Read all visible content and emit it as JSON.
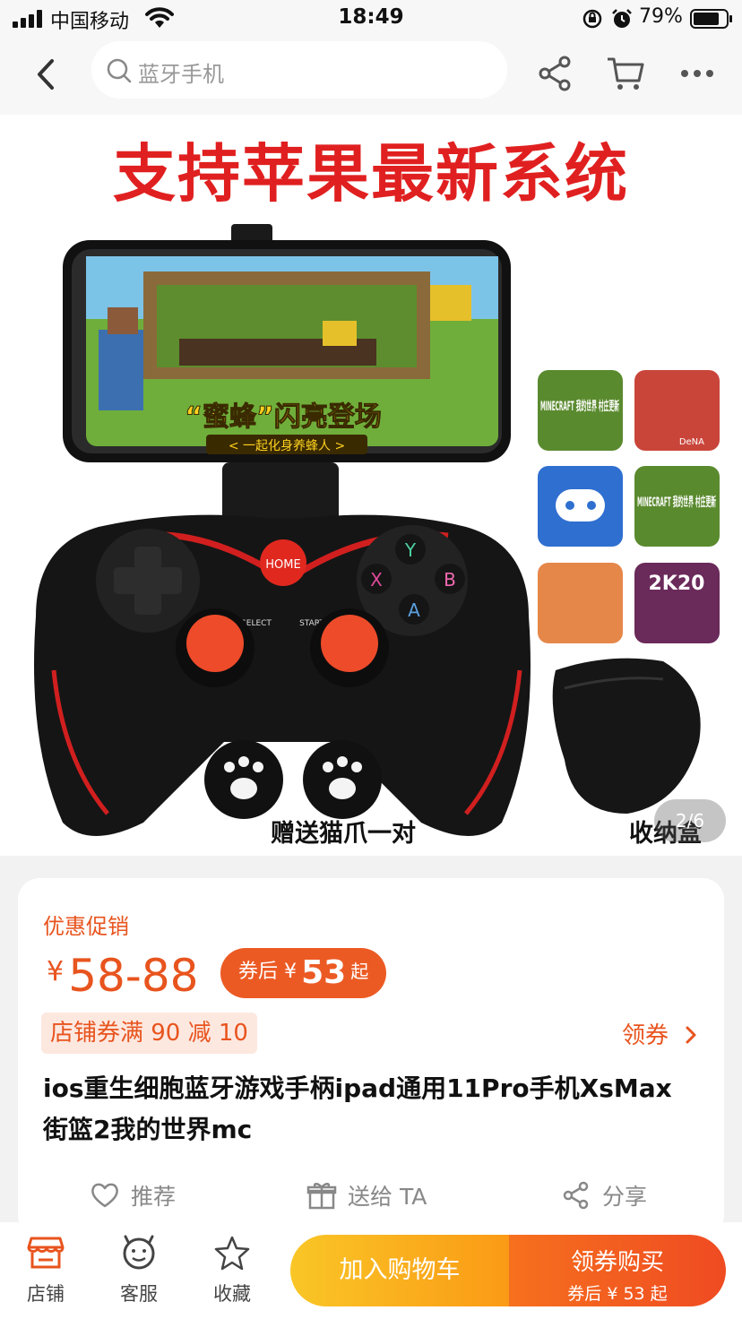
{
  "status_bar": {
    "carrier": "中国移动",
    "time": "18:49",
    "battery": "79%",
    "battery_level": 0.79
  },
  "nav": {
    "search_placeholder": "蓝牙手机"
  },
  "gallery": {
    "banner_text": "支持苹果最新系统",
    "phone_screen_title": "“蜜蜂”闪亮登场",
    "phone_screen_subtitle": "< 一起化身养蜂人 >",
    "game_icons": [
      "MINECRAFT 我的世界 村庄更新",
      "DeNA",
      "MINECRAFT 我的世界 村庄更新",
      "2K20"
    ],
    "controller_buttons": [
      "Y",
      "X",
      "B",
      "A"
    ],
    "controller_small_labels": [
      "SELECT",
      "START",
      "HOME"
    ],
    "caption_paw": "赠送猫爪一对",
    "caption_case": "收纳盒",
    "counter": "2/6"
  },
  "product": {
    "promo_label": "优惠促销",
    "currency": "¥",
    "price_range": "58-88",
    "coupon_prefix": "券后 ¥",
    "coupon_price": "53",
    "coupon_suffix": "起",
    "store_coupon": "店铺券满 90 减 10",
    "get_coupon": "领券",
    "title": "ios重生细胞蓝牙游戏手柄ipad通用11Pro手机XsMax街篮2我的世界mc",
    "actions": {
      "recommend": "推荐",
      "gift": "送给 TA",
      "share": "分享"
    }
  },
  "bottom_bar": {
    "store": "店铺",
    "service": "客服",
    "favorite": "收藏",
    "add_to_cart": "加入购物车",
    "buy": "领券购买",
    "buy_sub": "券后 ¥ 53 起"
  },
  "colors": {
    "accent": "#e8541e",
    "banner_red": "#e02020",
    "cart_gradient": [
      "#f9c626",
      "#fb9a16"
    ],
    "buy_gradient": [
      "#f6701e",
      "#ef4b22"
    ]
  }
}
